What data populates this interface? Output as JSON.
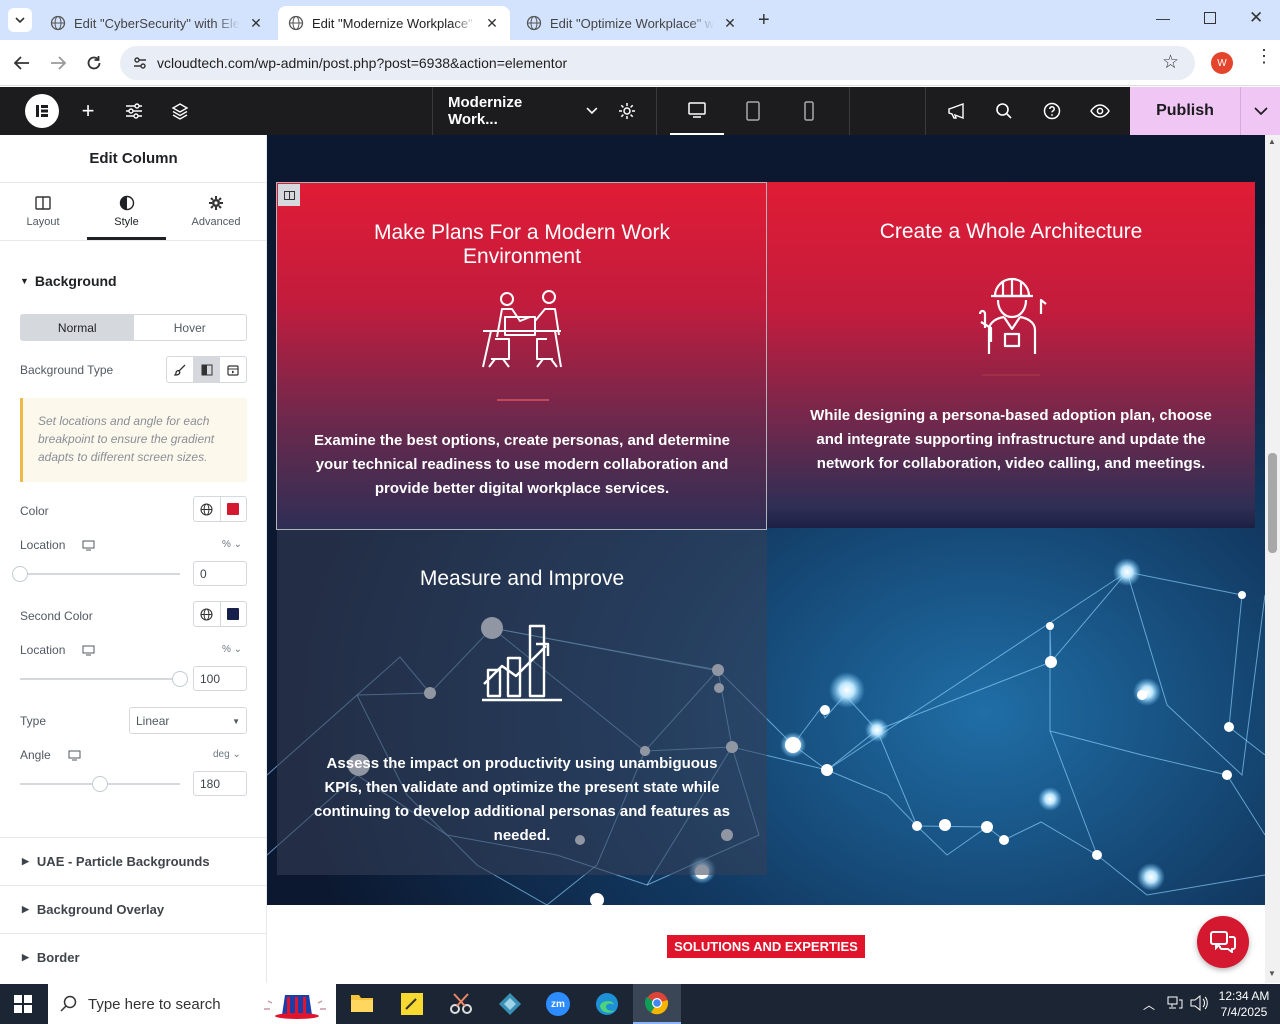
{
  "browser": {
    "tabs": [
      {
        "title": "Edit \"CyberSecurity\" with Elementor",
        "active": false
      },
      {
        "title": "Edit \"Modernize Workplace\" with Elementor",
        "active": true
      },
      {
        "title": "Edit \"Optimize Workplace\" with Elementor",
        "active": false
      }
    ],
    "url": "vcloudtech.com/wp-admin/post.php?post=6938&action=elementor",
    "profile_initial": "W"
  },
  "editor": {
    "document_title": "Modernize Work...",
    "publish_label": "Publish"
  },
  "panel": {
    "title": "Edit Column",
    "tabs": [
      "Layout",
      "Style",
      "Advanced"
    ],
    "active_tab": "Style",
    "section_background": "Background",
    "state_normal": "Normal",
    "state_hover": "Hover",
    "background_type_label": "Background Type",
    "notice": "Set locations and angle for each breakpoint to ensure the gradient adapts to different screen sizes.",
    "color_label": "Color",
    "color_value": "#d4182f",
    "location_label": "Location",
    "location_value": "0",
    "location_unit": "%",
    "second_color_label": "Second Color",
    "second_color_value": "#16204a",
    "second_location_label": "Location",
    "second_location_value": "100",
    "second_location_unit": "%",
    "type_label": "Type",
    "type_value": "Linear",
    "angle_label": "Angle",
    "angle_value": "180",
    "angle_unit": "deg",
    "sections": [
      "UAE - Particle Backgrounds",
      "Background Overlay",
      "Border"
    ]
  },
  "canvas": {
    "cards": [
      {
        "title": "Make Plans For a Modern Work Environment",
        "text": "Examine the best options, create personas, and determine your technical readiness to use modern collaboration and provide better digital workplace services.",
        "icon": "team-meeting-icon"
      },
      {
        "title": "Create a Whole Architecture",
        "text": "While designing a persona-based adoption plan, choose and integrate supporting infrastructure and update the network for collaboration, video calling, and meetings.",
        "icon": "engineer-icon"
      },
      {
        "title": "Measure and Improve",
        "text": "Assess the impact on productivity using unambiguous KPIs, then validate and optimize the present state while continuing to develop additional personas and features as needed.",
        "icon": "growth-chart-icon"
      }
    ],
    "section_badge": "SOLUTIONS AND EXPERTIES"
  },
  "taskbar": {
    "search_placeholder": "Type here to search",
    "time": "12:34 AM",
    "date": "7/4/2025"
  },
  "colors": {
    "accent_pink": "#f0c6f5",
    "card_red": "#d4182f",
    "card_navy": "#2a2f55",
    "badge_red": "#e0142b"
  }
}
